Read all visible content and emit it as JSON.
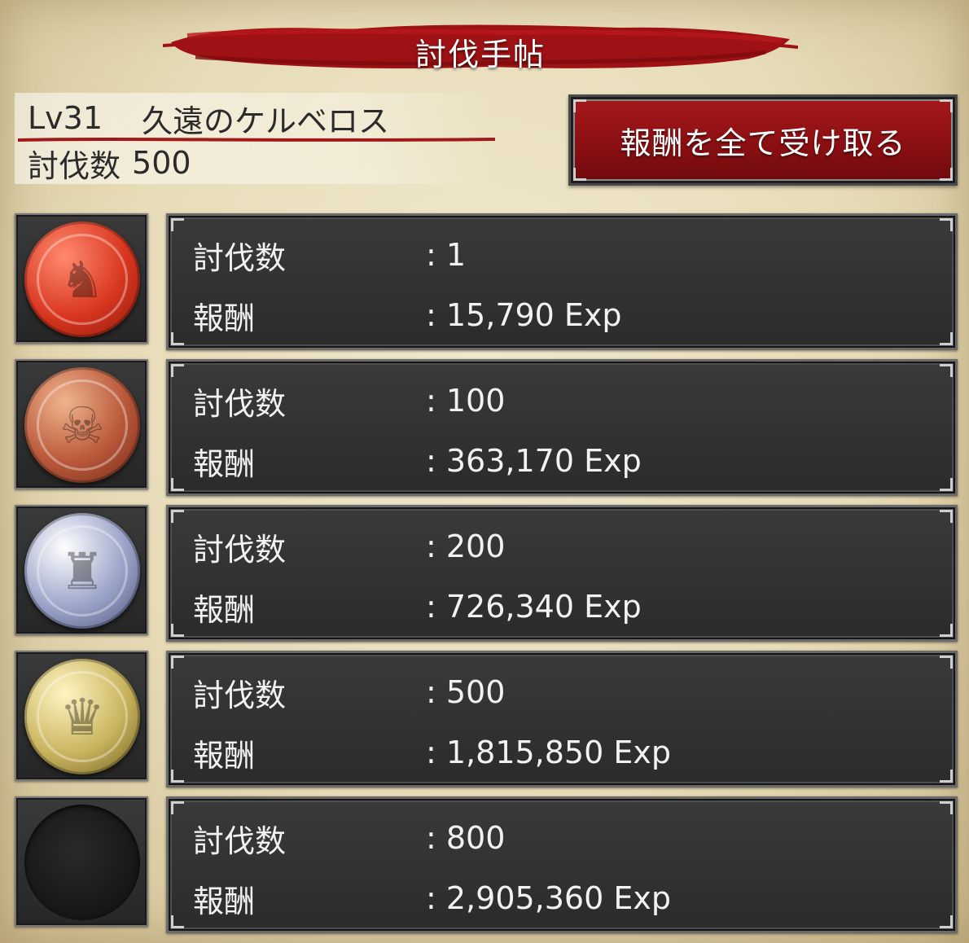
{
  "title": "討伐手帖",
  "monster": {
    "level": "Lv31",
    "name": "久遠のケルベロス",
    "kill_label": "討伐数",
    "kill_count": "500"
  },
  "claim_all_label": "報酬を全て受け取る",
  "colors": {
    "accent_red": "#a8191c",
    "panel_dark": "#2f2f2f",
    "parchment": "#e9dfbd"
  },
  "rewards": [
    {
      "medal": "red-medal-icon",
      "count_label": "討伐数",
      "count_value": ": 1",
      "reward_label": "報酬",
      "reward_value": ": 15,790 Exp"
    },
    {
      "medal": "bronze-medal-icon",
      "count_label": "討伐数",
      "count_value": ": 100",
      "reward_label": "報酬",
      "reward_value": ": 363,170 Exp"
    },
    {
      "medal": "silver-medal-icon",
      "count_label": "討伐数",
      "count_value": ": 200",
      "reward_label": "報酬",
      "reward_value": ": 726,340 Exp"
    },
    {
      "medal": "gold-medal-icon",
      "count_label": "討伐数",
      "count_value": ": 500",
      "reward_label": "報酬",
      "reward_value": ": 1,815,850 Exp"
    },
    {
      "medal": "empty-medal-slot-icon",
      "count_label": "討伐数",
      "count_value": ": 800",
      "reward_label": "報酬",
      "reward_value": ": 2,905,360 Exp"
    }
  ]
}
